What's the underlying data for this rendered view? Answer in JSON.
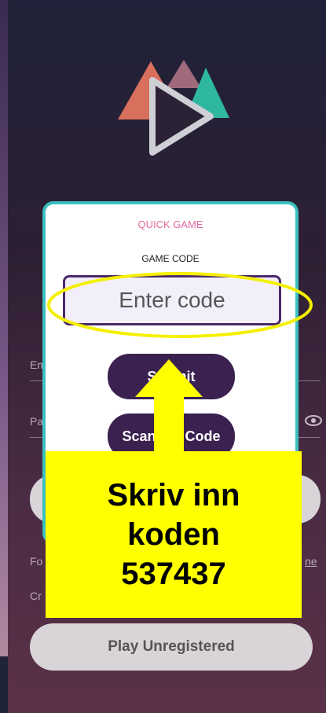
{
  "quick_game": {
    "title": "QUICK GAME",
    "game_code_label": "GAME CODE",
    "code_placeholder": "Enter code",
    "submit_label": "Submit",
    "scan_label": "Scan QR Code"
  },
  "login_bg": {
    "email_label": "Em",
    "password_label": "Pa",
    "forgot_label": "Fo",
    "forgot_right": "ne",
    "create_label": "Cr",
    "play_unregistered": "Play Unregistered"
  },
  "callout": {
    "line1": "Skriv inn",
    "line2": "koden",
    "line3": "537437"
  },
  "colors": {
    "accent_pink": "#e46aa0",
    "card_border": "#3bc0c0",
    "dark_button": "#3a2150",
    "highlight": "#ffff00"
  }
}
